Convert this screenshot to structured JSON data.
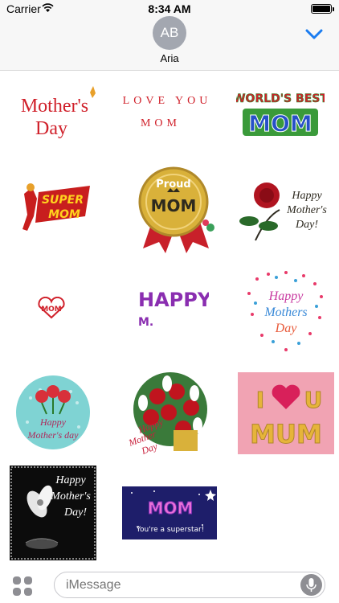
{
  "status_bar": {
    "carrier": "Carrier",
    "time": "8:34 AM"
  },
  "header": {
    "avatar_initials": "AB",
    "contact_name": "Aria",
    "collapse_icon": "chevron-down-icon"
  },
  "stickers": [
    {
      "id": "mothers-day-text",
      "lines": [
        "Mother's",
        "Day"
      ]
    },
    {
      "id": "love-you-mom",
      "lines": [
        "LOVE YOU",
        "MOM"
      ]
    },
    {
      "id": "worlds-best-mom",
      "lines": [
        "WORLD'S BEST",
        "MOM"
      ]
    },
    {
      "id": "super-mom",
      "lines": [
        "SUPER",
        "MOM"
      ]
    },
    {
      "id": "proud-mom",
      "lines": [
        "Proud",
        "MOM"
      ]
    },
    {
      "id": "rose-happy-mothers-day",
      "lines": [
        "Happy",
        "Mother's",
        "Day!"
      ]
    },
    {
      "id": "mom-heart",
      "lines": [
        "MOM"
      ]
    },
    {
      "id": "happy-m",
      "lines": [
        "HAPPY",
        "M."
      ]
    },
    {
      "id": "hearts-happy-mothers-day",
      "lines": [
        "Happy",
        "Mothers",
        "Day"
      ]
    },
    {
      "id": "roses-circle",
      "lines": [
        "Happy",
        "Mother's day"
      ]
    },
    {
      "id": "bouquet",
      "lines": [
        "Happy",
        "Mother",
        "Day"
      ]
    },
    {
      "id": "i-love-u-mum",
      "lines": [
        "I",
        "U",
        "MUM"
      ]
    },
    {
      "id": "lily-happy-mothers-day",
      "lines": [
        "Happy",
        "Mother's",
        "Day!"
      ]
    },
    {
      "id": "superstar",
      "lines": [
        "MOM",
        "You're a superstar!"
      ]
    }
  ],
  "input_bar": {
    "placeholder": "iMessage",
    "apps_icon": "app-grid-icon",
    "mic_icon": "microphone-icon"
  },
  "colors": {
    "accent": "#1a7cf0",
    "red": "#d0202a",
    "gold": "#d9b13a"
  }
}
